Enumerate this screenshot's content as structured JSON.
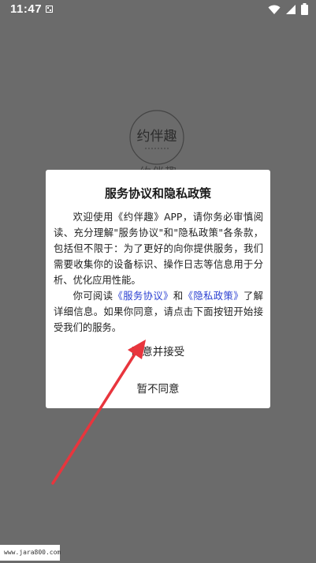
{
  "status_bar": {
    "time": "11:47",
    "icons": [
      "notification-icon",
      "wifi-icon",
      "signal-icon",
      "battery-icon"
    ]
  },
  "splash": {
    "logo_text": "约伴趣",
    "app_name": "约伴趣"
  },
  "dialog": {
    "title": "服务协议和隐私政策",
    "paragraph1": "欢迎使用《约伴趣》APP，请你务必审慎阅读、充分理解\"服务协议\"和\"隐私政策\"各条款，包括但不限于：为了更好的向你提供服务，我们需要收集你的设备标识、操作日志等信息用于分析、优化应用性能。",
    "paragraph2_prefix": "你可阅读",
    "service_link": "《服务协议》",
    "paragraph2_and": "和",
    "privacy_link": "《隐私政策》",
    "paragraph2_suffix": "了解详细信息。如果你同意，请点击下面按钮开始接受我们的服务。",
    "agree_button": "同意并接受",
    "disagree_button": "暂不同意"
  },
  "watermark": "www.jara800.com",
  "colors": {
    "overlay": "#6b6b6b",
    "link": "#2a3fd1",
    "arrow": "#e8353d"
  }
}
